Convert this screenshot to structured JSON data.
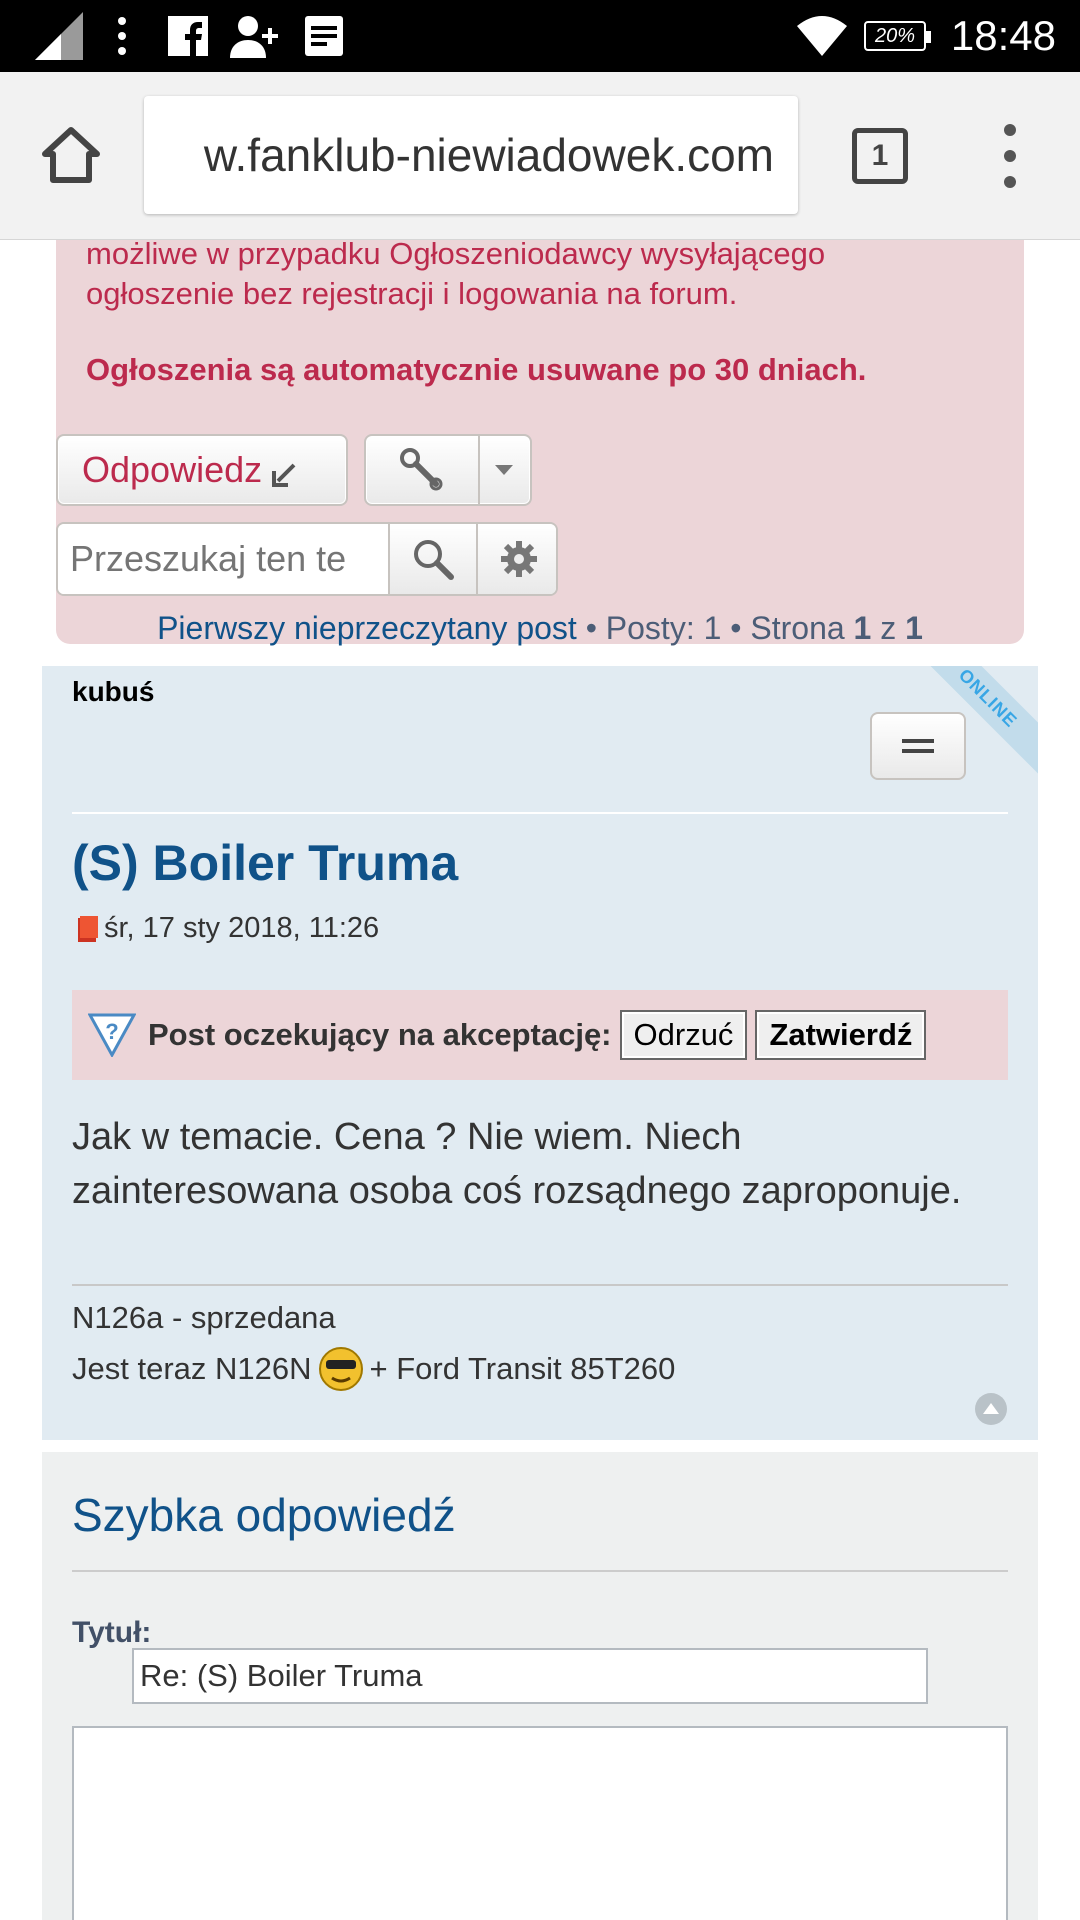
{
  "status_bar": {
    "time": "18:48",
    "battery": "20%",
    "icons": [
      "signal-icon",
      "overflow-dots-icon",
      "facebook-icon",
      "add-contact-icon",
      "news-icon",
      "wifi-icon",
      "battery-icon"
    ]
  },
  "browser": {
    "url": "w.fanklub-niewiadowek.com",
    "tab_count": "1"
  },
  "notice": {
    "line1": "możliwe w przypadku Ogłoszeniodawcy wysyłającego",
    "line2": "ogłoszenie bez rejestracji i logowania na forum.",
    "bold_line": "Ogłoszenia są automatycznie usuwane po 30 dniach."
  },
  "actions": {
    "reply_label": "Odpowiedz",
    "search_placeholder": "Przeszukaj ten te"
  },
  "pagination": {
    "first_unread": "Pierwszy nieprzeczytany post",
    "sep1": " • Posty: 1 • Strona ",
    "page": "1",
    "of": " z ",
    "total_pages": "1"
  },
  "post": {
    "online_badge": "ONLINE",
    "author": "kubuś",
    "title": "(S) Boiler Truma",
    "date": "śr, 17 sty 2018, 11:26",
    "approval_label": "Post oczekujący na akceptację:",
    "reject_label": "Odrzuć",
    "approve_label": "Zatwierdź",
    "body": "Jak w temacie. Cena ? Nie wiem. Niech zainteresowana osoba coś rozsądnego zaproponuje.",
    "signature_line1": "N126a - sprzedana",
    "signature_line2_before": "Jest teraz N126N",
    "signature_line2_after": "+ Ford Transit 85T260"
  },
  "quick_reply": {
    "title": "Szybka odpowiedź",
    "subject_label": "Tytuł:",
    "subject_value": "Re: (S) Boiler Truma"
  },
  "colors": {
    "notice_bg": "#ecd5d8",
    "notice_text": "#bc2a4d",
    "post_bg": "#e1ebf2",
    "link": "#105289",
    "quick_reply_bg": "#eef0f0"
  }
}
